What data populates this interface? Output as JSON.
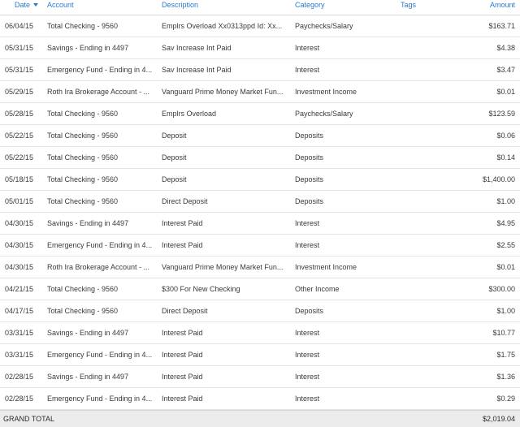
{
  "header": {
    "date": "Date",
    "account": "Account",
    "description": "Description",
    "category": "Category",
    "tags": "Tags",
    "amount": "Amount"
  },
  "rows": [
    {
      "date": "06/04/15",
      "account": "Total Checking - 9560",
      "description": "Emplrs Overload Xx0313ppd Id: Xx...",
      "category": "Paychecks/Salary",
      "tags": "",
      "amount": "$163.71"
    },
    {
      "date": "05/31/15",
      "account": "Savings - Ending in 4497",
      "description": "Sav Increase Int Paid",
      "category": "Interest",
      "tags": "",
      "amount": "$4.38"
    },
    {
      "date": "05/31/15",
      "account": "Emergency Fund - Ending in 4...",
      "description": "Sav Increase Int Paid",
      "category": "Interest",
      "tags": "",
      "amount": "$3.47"
    },
    {
      "date": "05/29/15",
      "account": "Roth Ira Brokerage Account - ...",
      "description": "Vanguard Prime Money Market Fun...",
      "category": "Investment Income",
      "tags": "",
      "amount": "$0.01"
    },
    {
      "date": "05/28/15",
      "account": "Total Checking - 9560",
      "description": "Emplrs Overload",
      "category": "Paychecks/Salary",
      "tags": "",
      "amount": "$123.59"
    },
    {
      "date": "05/22/15",
      "account": "Total Checking - 9560",
      "description": "Deposit",
      "category": "Deposits",
      "tags": "",
      "amount": "$0.06"
    },
    {
      "date": "05/22/15",
      "account": "Total Checking - 9560",
      "description": "Deposit",
      "category": "Deposits",
      "tags": "",
      "amount": "$0.14"
    },
    {
      "date": "05/18/15",
      "account": "Total Checking - 9560",
      "description": "Deposit",
      "category": "Deposits",
      "tags": "",
      "amount": "$1,400.00"
    },
    {
      "date": "05/01/15",
      "account": "Total Checking - 9560",
      "description": "Direct Deposit",
      "category": "Deposits",
      "tags": "",
      "amount": "$1.00"
    },
    {
      "date": "04/30/15",
      "account": "Savings - Ending in 4497",
      "description": "Interest Paid",
      "category": "Interest",
      "tags": "",
      "amount": "$4.95"
    },
    {
      "date": "04/30/15",
      "account": "Emergency Fund - Ending in 4...",
      "description": "Interest Paid",
      "category": "Interest",
      "tags": "",
      "amount": "$2.55"
    },
    {
      "date": "04/30/15",
      "account": "Roth Ira Brokerage Account - ...",
      "description": "Vanguard Prime Money Market Fun...",
      "category": "Investment Income",
      "tags": "",
      "amount": "$0.01"
    },
    {
      "date": "04/21/15",
      "account": "Total Checking - 9560",
      "description": "$300 For New Checking",
      "category": "Other Income",
      "tags": "",
      "amount": "$300.00"
    },
    {
      "date": "04/17/15",
      "account": "Total Checking - 9560",
      "description": "Direct Deposit",
      "category": "Deposits",
      "tags": "",
      "amount": "$1.00"
    },
    {
      "date": "03/31/15",
      "account": "Savings - Ending in 4497",
      "description": "Interest Paid",
      "category": "Interest",
      "tags": "",
      "amount": "$10.77"
    },
    {
      "date": "03/31/15",
      "account": "Emergency Fund - Ending in 4...",
      "description": "Interest Paid",
      "category": "Interest",
      "tags": "",
      "amount": "$1.75"
    },
    {
      "date": "02/28/15",
      "account": "Savings - Ending in 4497",
      "description": "Interest Paid",
      "category": "Interest",
      "tags": "",
      "amount": "$1.36"
    },
    {
      "date": "02/28/15",
      "account": "Emergency Fund - Ending in 4...",
      "description": "Interest Paid",
      "category": "Interest",
      "tags": "",
      "amount": "$0.29"
    }
  ],
  "footer": {
    "label": "GRAND TOTAL",
    "amount": "$2,019.04"
  },
  "icons": {
    "sort": "sort-descending-caret-icon"
  },
  "colors": {
    "header_link": "#2a7ad1",
    "footer_bg": "#ececec"
  }
}
